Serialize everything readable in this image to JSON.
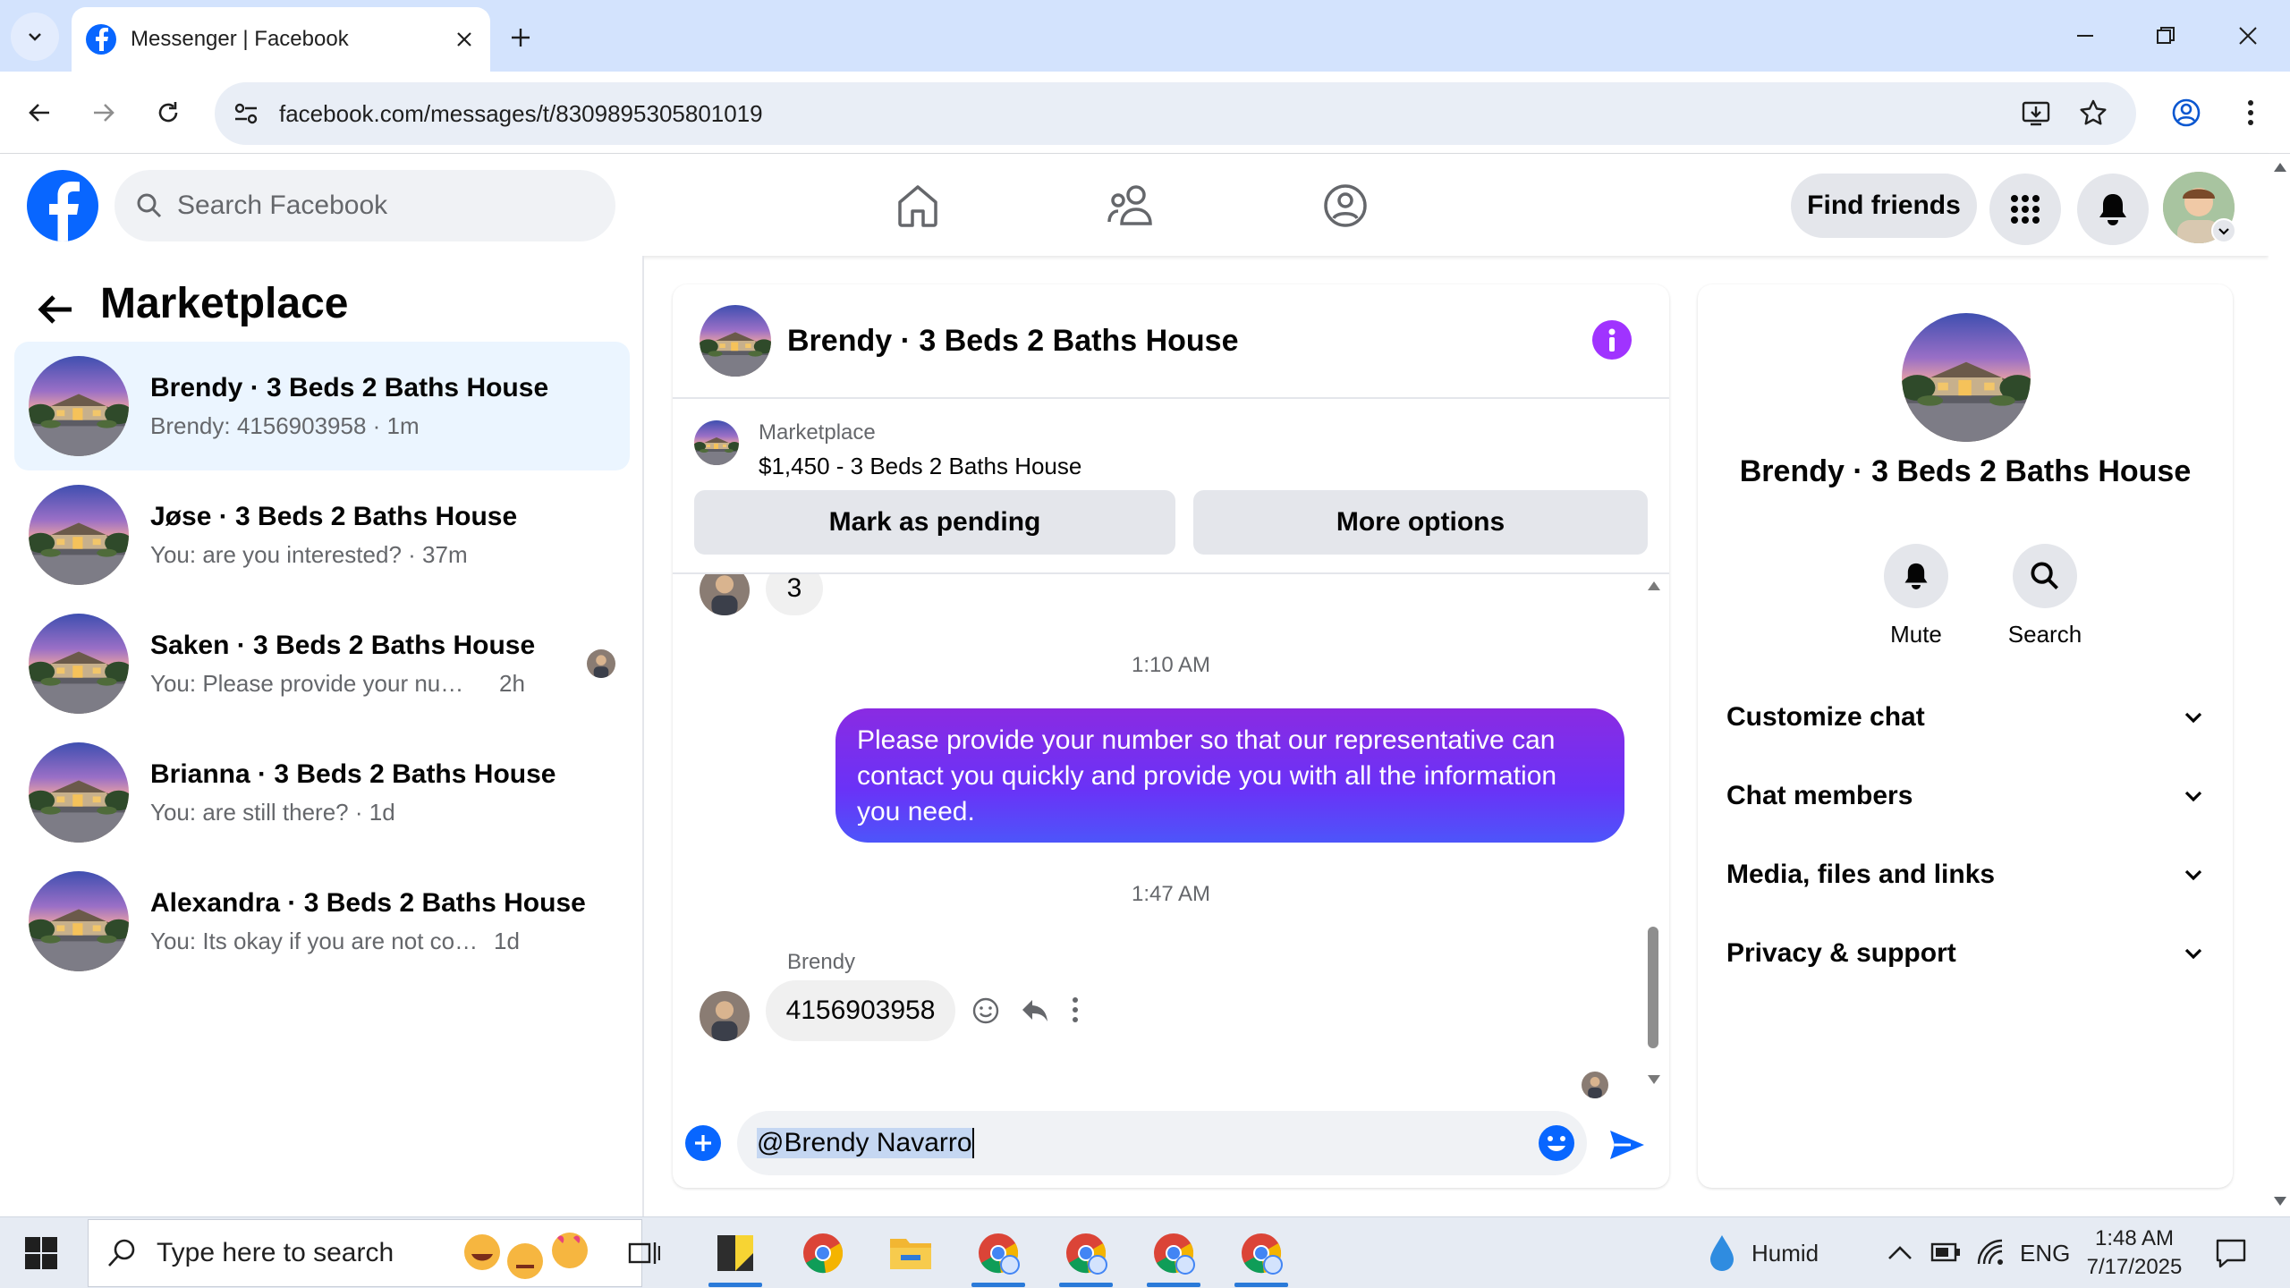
{
  "browser": {
    "tab_title": "Messenger | Facebook",
    "url": "facebook.com/messages/t/8309895305801019"
  },
  "fb": {
    "search_placeholder": "Search Facebook",
    "find_friends": "Find friends"
  },
  "left": {
    "title": "Marketplace",
    "conversations": [
      {
        "name": "Brendy · 3 Beds 2 Baths House",
        "preview": "Brendy: 4156903958",
        "time": "1m"
      },
      {
        "name": "Jøse · 3 Beds 2 Baths House",
        "preview": "You: are you interested?",
        "time": "37m"
      },
      {
        "name": "Saken · 3 Beds 2 Baths House",
        "preview": "You: Please provide your number s...",
        "time": "2h"
      },
      {
        "name": "Brianna · 3 Beds 2 Baths House",
        "preview": "You: are still there?",
        "time": "1d"
      },
      {
        "name": "Alexandra · 3 Beds 2 Baths House",
        "preview": "You: Its okay if you are not comfortabl...",
        "time": "1d"
      }
    ]
  },
  "chat": {
    "title": "Brendy · 3 Beds 2 Baths House",
    "listing_label": "Marketplace",
    "listing_price": "$1,450 - 3 Beds 2 Baths House",
    "mark_pending": "Mark as pending",
    "more_options": "More options",
    "prev_message": "3",
    "time1": "1:10 AM",
    "outgoing": "Please provide your number so that our representative can contact you quickly and provide you with all the information you need.",
    "time2": "1:47 AM",
    "sender": "Brendy",
    "incoming": "4156903958",
    "input_value": "@Brendy Navarro"
  },
  "right": {
    "name": "Brendy · 3 Beds 2 Baths House",
    "mute": "Mute",
    "search": "Search",
    "sections": [
      "Customize chat",
      "Chat members",
      "Media, files and links",
      "Privacy & support"
    ]
  },
  "taskbar": {
    "search_text": "Type here to search",
    "weather": "Humid",
    "lang": "ENG",
    "time": "1:48 AM",
    "date": "7/17/2025"
  },
  "colors": {
    "fb_blue": "#0866ff",
    "accent_purple": "#a033ff",
    "active_conv": "#ebf5ff"
  }
}
